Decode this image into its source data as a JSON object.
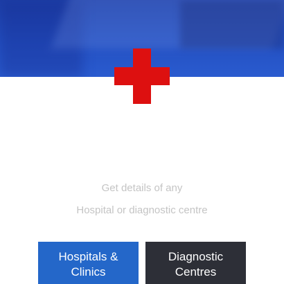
{
  "colors": {
    "header_blue": "#2350c2",
    "cross_red": "#dd1010",
    "hospitals_button": "#2467c9",
    "diagnostic_button": "#2d2f37",
    "tagline_text": "#c4c4c4"
  },
  "icons": {
    "logo": "red-cross-icon"
  },
  "tagline": {
    "line1": "Get details of any",
    "line2": "Hospital or diagnostic centre"
  },
  "buttons": {
    "hospitals": "Hospitals &\nClinics",
    "diagnostic": "Diagnostic\nCentres"
  }
}
